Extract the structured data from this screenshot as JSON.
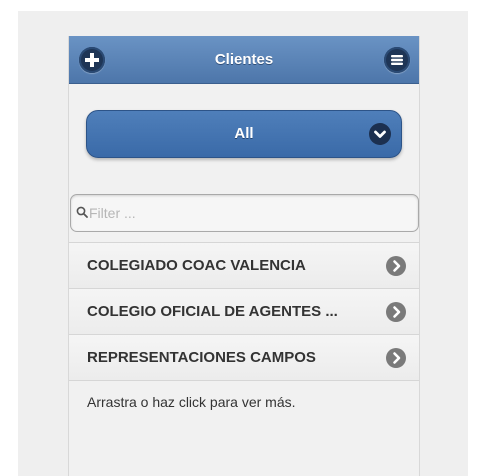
{
  "header": {
    "title": "Clientes",
    "add_icon": "plus-icon",
    "menu_icon": "bars-icon"
  },
  "select": {
    "value": "All",
    "icon": "chevron-down-icon"
  },
  "filter": {
    "placeholder": "Filter ...",
    "value": "",
    "icon": "search-icon"
  },
  "clients": [
    {
      "label": "COLEGIADO COAC VALENCIA"
    },
    {
      "label": "COLEGIO OFICIAL DE AGENTES ..."
    },
    {
      "label": "REPRESENTACIONES CAMPOS"
    }
  ],
  "footer": {
    "text": "Arrastra o haz click para ver más."
  },
  "colors": {
    "header": "#5a83b8",
    "button": "#4070ae",
    "background": "#f1f1f1"
  }
}
